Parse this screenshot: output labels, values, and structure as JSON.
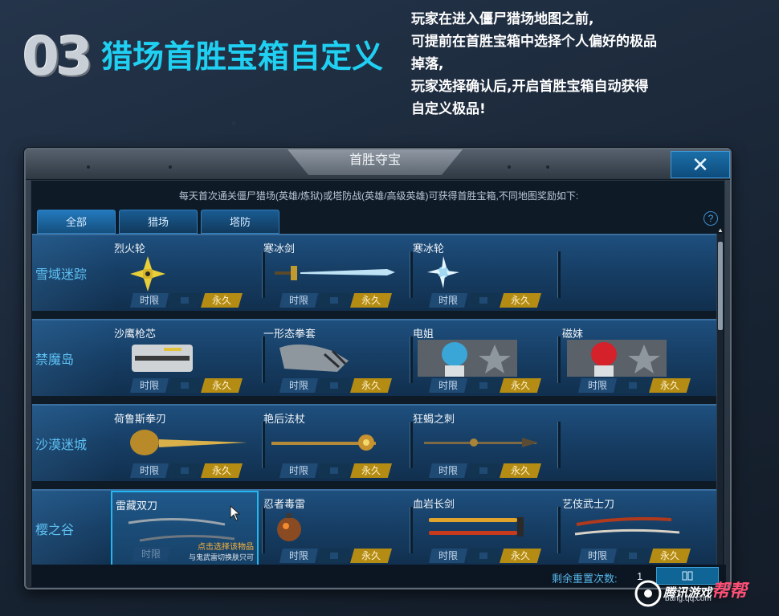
{
  "header": {
    "number": "03",
    "title": "猎场首胜宝箱自定义",
    "description": [
      "玩家在进入僵尸猎场地图之前,",
      "可提前在首胜宝箱中选择个人偏好的极品",
      "掉落,",
      "玩家选择确认后,开启首胜宝箱自动获得",
      "自定义极品!"
    ]
  },
  "dialog": {
    "title": "首胜夺宝",
    "intro": "每天首次通关僵尸猎场(英雄/炼狱)或塔防战(英雄/高级英雄)可获得首胜宝箱,不同地图奖励如下:",
    "tabs": [
      "全部",
      "猎场",
      "塔防"
    ],
    "help_symbol": "?",
    "tag_temp": "时限",
    "tag_perm": "永久",
    "rows": [
      {
        "label": "雪域迷踪",
        "items": [
          "烈火轮",
          "寒冰剑",
          "寒冰轮"
        ]
      },
      {
        "label": "禁魔岛",
        "items": [
          "沙鹰枪芯",
          "一形态拳套",
          "电姐",
          "磁妹"
        ]
      },
      {
        "label": "沙漠迷城",
        "items": [
          "荷鲁斯拳刃",
          "艳后法杖",
          "狂蝎之刺"
        ]
      },
      {
        "label": "樱之谷",
        "items": [
          "雷藏双刀",
          "忍者毒雷",
          "血岩长剑",
          "艺伎武士刀"
        ]
      }
    ],
    "selected_tip": "点击选择该物品",
    "selected_note": "与鬼武雷切换肤只可",
    "reset_label": "剩余重置次数:",
    "reset_count": "1"
  },
  "watermark": {
    "title_prefix": "腾讯游戏",
    "title_emph": "帮帮",
    "url": "bang.qq.com"
  },
  "colors": {
    "title_cyan": "#1fd0f2",
    "row_label": "#5ec2f5",
    "perm_gold": "#b58c13",
    "select_border": "#23b7f0"
  }
}
